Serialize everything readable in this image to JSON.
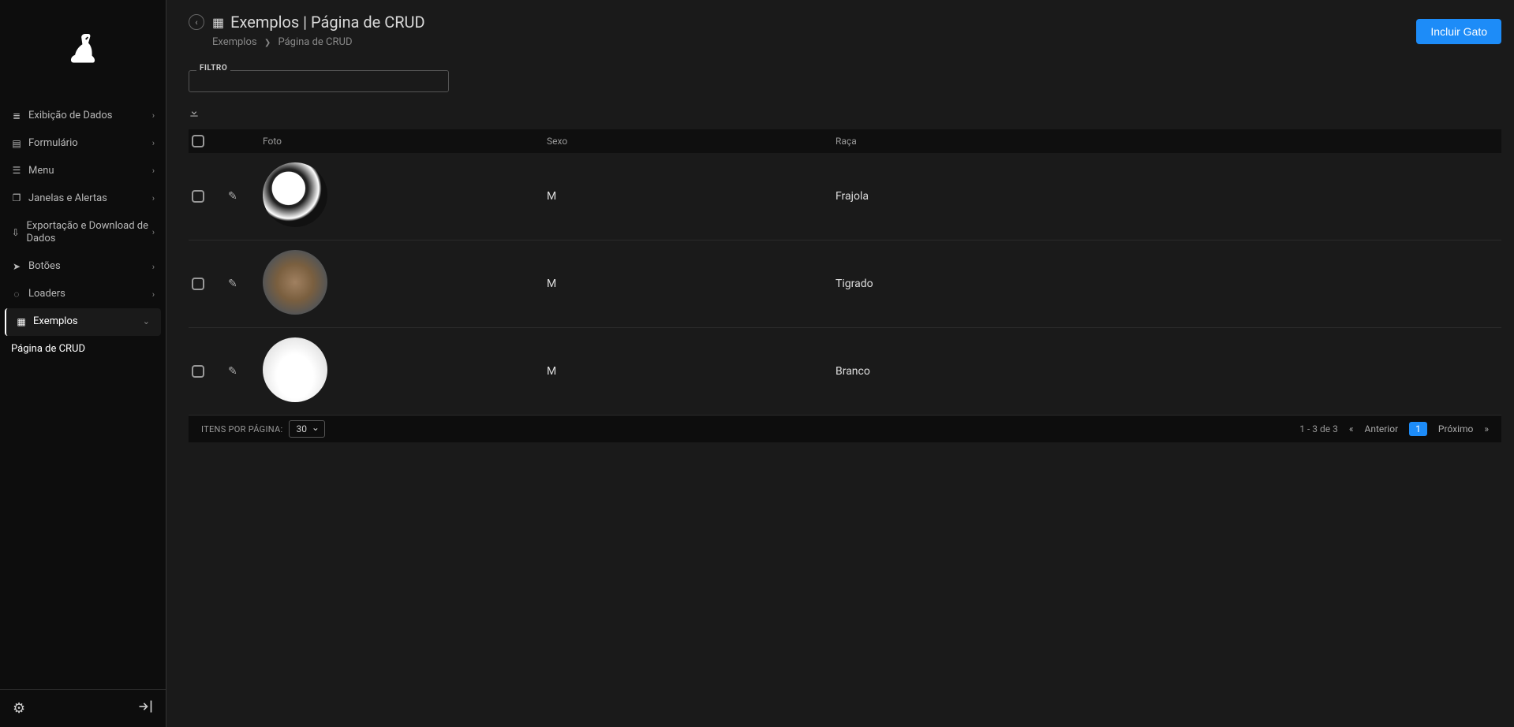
{
  "sidebar": {
    "items": [
      {
        "label": "Exibição de Dados",
        "icon": "database-icon",
        "glyph": "≣"
      },
      {
        "label": "Formulário",
        "icon": "form-icon",
        "glyph": "▤"
      },
      {
        "label": "Menu",
        "icon": "menu-icon",
        "glyph": "☰"
      },
      {
        "label": "Janelas e Alertas",
        "icon": "window-icon",
        "glyph": "❐"
      },
      {
        "label": "Exportação e Download de Dados",
        "icon": "export-icon",
        "glyph": "⇩"
      },
      {
        "label": "Botões",
        "icon": "pointer-icon",
        "glyph": "➤"
      },
      {
        "label": "Loaders",
        "icon": "loader-icon",
        "glyph": "◌"
      },
      {
        "label": "Exemplos",
        "icon": "book-icon",
        "glyph": "▦",
        "expanded": true,
        "children": [
          "Página de CRUD"
        ]
      }
    ]
  },
  "header": {
    "title": "Exemplos | Página de CRUD",
    "primary_button": "Incluir Gato",
    "breadcrumb": [
      "Exemplos",
      "Página de CRUD"
    ]
  },
  "filter": {
    "label": "FILTRO",
    "value": ""
  },
  "table": {
    "columns": {
      "foto": "Foto",
      "sexo": "Sexo",
      "raca": "Raça"
    },
    "rows": [
      {
        "sexo": "M",
        "raca": "Frajola"
      },
      {
        "sexo": "M",
        "raca": "Tigrado"
      },
      {
        "sexo": "M",
        "raca": "Branco"
      }
    ]
  },
  "pagination": {
    "items_label": "ITENS POR PÁGINA:",
    "per_page": "30",
    "range": "1 - 3 de 3",
    "prev": "Anterior",
    "next": "Próximo",
    "current_page": "1"
  }
}
